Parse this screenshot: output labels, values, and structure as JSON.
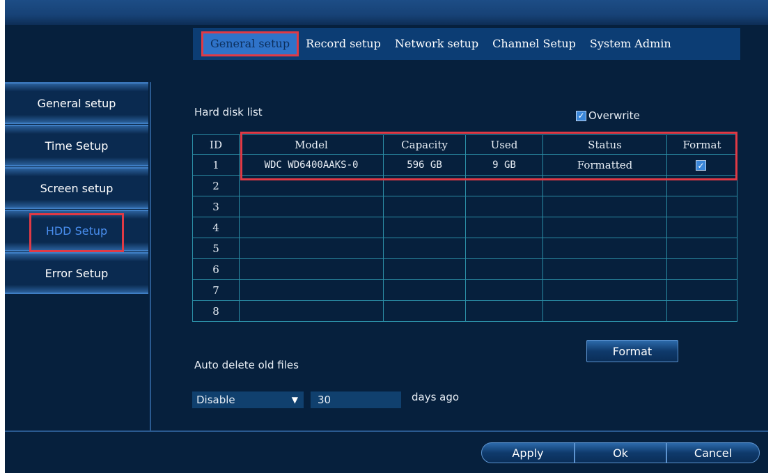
{
  "tabs": [
    "General setup",
    "Record setup",
    "Network setup",
    "Channel Setup",
    "System Admin"
  ],
  "sidebar": {
    "items": [
      {
        "label": "General setup"
      },
      {
        "label": "Time Setup"
      },
      {
        "label": "Screen setup"
      },
      {
        "label": "HDD Setup"
      },
      {
        "label": "Error Setup"
      }
    ],
    "active": "HDD Setup"
  },
  "hdd": {
    "list_label": "Hard disk list",
    "overwrite_label": "Overwrite",
    "overwrite_checked": true,
    "columns": [
      "ID",
      "Model",
      "Capacity",
      "Used",
      "Status",
      "Format"
    ],
    "rows": [
      {
        "id": "1",
        "model": "WDC WD6400AAKS-0",
        "capacity": "596 GB",
        "used": "9 GB",
        "status": "Formatted",
        "format_checked": true
      },
      {
        "id": "2",
        "model": "",
        "capacity": "",
        "used": "",
        "status": "",
        "format_checked": false
      },
      {
        "id": "3",
        "model": "",
        "capacity": "",
        "used": "",
        "status": "",
        "format_checked": false
      },
      {
        "id": "4",
        "model": "",
        "capacity": "",
        "used": "",
        "status": "",
        "format_checked": false
      },
      {
        "id": "5",
        "model": "",
        "capacity": "",
        "used": "",
        "status": "",
        "format_checked": false
      },
      {
        "id": "6",
        "model": "",
        "capacity": "",
        "used": "",
        "status": "",
        "format_checked": false
      },
      {
        "id": "7",
        "model": "",
        "capacity": "",
        "used": "",
        "status": "",
        "format_checked": false
      },
      {
        "id": "8",
        "model": "",
        "capacity": "",
        "used": "",
        "status": "",
        "format_checked": false
      }
    ],
    "format_button": "Format",
    "auto_delete_label": "Auto delete old files",
    "auto_delete_value": "Disable",
    "days_value": "30",
    "days_suffix": "days ago"
  },
  "footer": {
    "apply": "Apply",
    "ok": "Ok",
    "cancel": "Cancel"
  },
  "colors": {
    "background": "#06203d",
    "highlight": "#e03a45",
    "accent": "#2f73c9",
    "grid": "#2b8ea6"
  }
}
